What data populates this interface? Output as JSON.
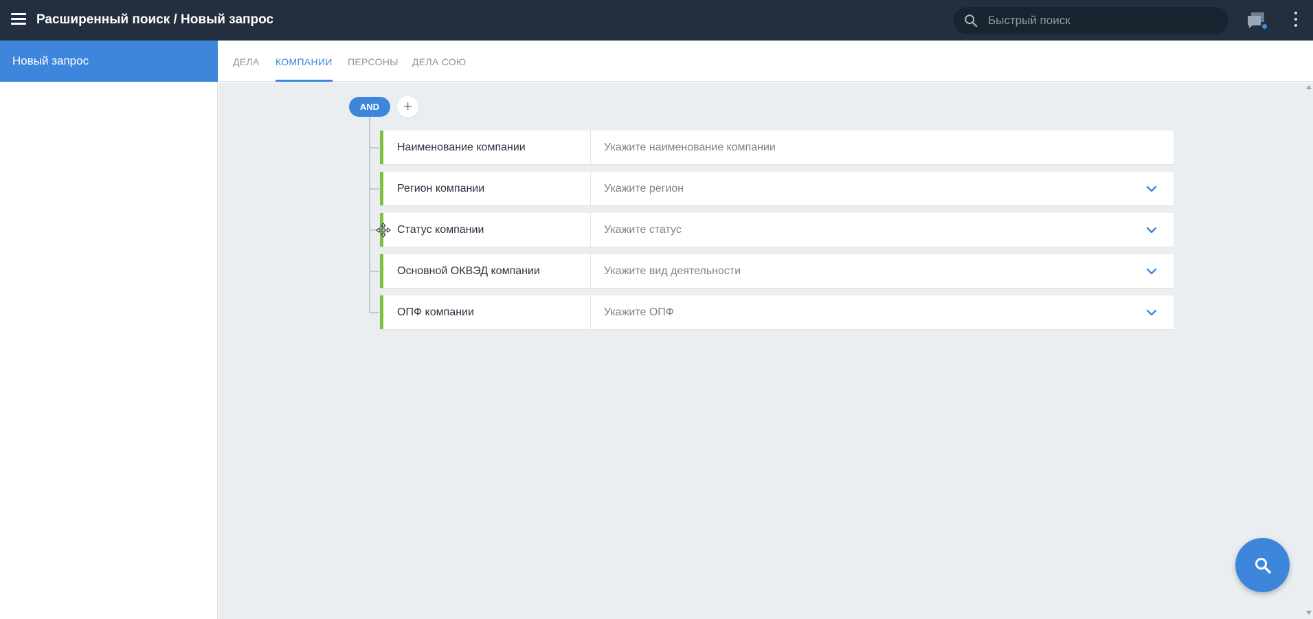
{
  "header": {
    "title": "Расширенный поиск / Новый запрос",
    "menu_icon": "hamburger-icon",
    "search_placeholder": "Быстрый поиск",
    "search_value": "",
    "chat_icon": "chat-icon",
    "more_icon": "kebab-menu-icon"
  },
  "sidebar": {
    "items": [
      {
        "label": "Новый запрос",
        "active": true
      }
    ]
  },
  "tabs": [
    {
      "label": "ДЕЛА",
      "active": false
    },
    {
      "label": "КОМПАНИИ",
      "active": true
    },
    {
      "label": "ПЕРСОНЫ",
      "active": false
    },
    {
      "label": "ДЕЛА СОЮ",
      "active": false
    }
  ],
  "query": {
    "operator": "AND",
    "add_label": "+",
    "conditions": [
      {
        "label": "Наименование компании",
        "placeholder": "Укажите наименование компании",
        "has_dropdown": false
      },
      {
        "label": "Регион компании",
        "placeholder": "Укажите регион",
        "has_dropdown": true
      },
      {
        "label": "Статус компании",
        "placeholder": "Укажите статус",
        "has_dropdown": true
      },
      {
        "label": "Основной ОКВЭД компании",
        "placeholder": "Укажите вид деятельности",
        "has_dropdown": true
      },
      {
        "label": "ОПФ компании",
        "placeholder": "Укажите ОПФ",
        "has_dropdown": true
      }
    ]
  },
  "colors": {
    "topbar": "#232f3e",
    "accent": "#3d86dc",
    "condition_marker": "#7cc142",
    "workspace": "#ebeef0"
  },
  "fab": {
    "icon": "search-icon"
  }
}
